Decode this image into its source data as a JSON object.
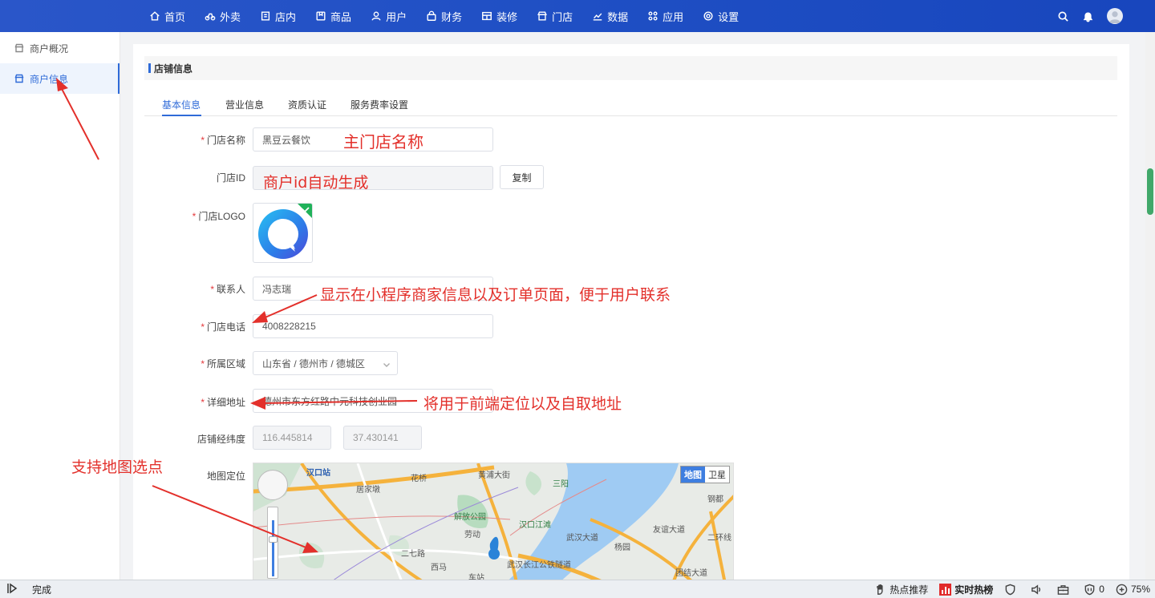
{
  "nav": {
    "items": [
      {
        "label": "首页",
        "icon": "home-icon"
      },
      {
        "label": "外卖",
        "icon": "bike-icon"
      },
      {
        "label": "店内",
        "icon": "store-inside-icon"
      },
      {
        "label": "商品",
        "icon": "goods-icon"
      },
      {
        "label": "用户",
        "icon": "user-icon"
      },
      {
        "label": "财务",
        "icon": "finance-icon"
      },
      {
        "label": "装修",
        "icon": "decorate-icon"
      },
      {
        "label": "门店",
        "icon": "shop-icon"
      },
      {
        "label": "数据",
        "icon": "chart-icon"
      },
      {
        "label": "应用",
        "icon": "apps-icon"
      },
      {
        "label": "设置",
        "icon": "gear-icon"
      }
    ]
  },
  "sidebar": {
    "items": [
      {
        "label": "商户概况",
        "active": false
      },
      {
        "label": "商户信息",
        "active": true
      }
    ]
  },
  "section": {
    "title": "店铺信息"
  },
  "tabs": [
    {
      "label": "基本信息",
      "active": true
    },
    {
      "label": "营业信息",
      "active": false
    },
    {
      "label": "资质认证",
      "active": false
    },
    {
      "label": "服务费率设置",
      "active": false
    }
  ],
  "form": {
    "store_name": {
      "label": "门店名称",
      "value": "黑豆云餐饮",
      "required": true
    },
    "store_id": {
      "label": "门店ID",
      "value": "",
      "copy_button": "复制",
      "required": false
    },
    "logo": {
      "label": "门店LOGO",
      "required": true
    },
    "contact": {
      "label": "联系人",
      "value": "冯志瑞",
      "required": true
    },
    "phone": {
      "label": "门店电话",
      "value": "4008228215",
      "required": true
    },
    "region": {
      "label": "所属区域",
      "value": "山东省 / 德州市 / 德城区",
      "required": true
    },
    "address": {
      "label": "详细地址",
      "value": "德州市东方红路中元科技创业园",
      "required": true
    },
    "latlng": {
      "label": "店铺经纬度",
      "lng": "116.445814",
      "lat": "37.430141"
    },
    "map": {
      "label": "地图定位",
      "type_map": "地图",
      "type_satellite": "卫星",
      "places": [
        "汉口站",
        "居家墩",
        "花桥",
        "解放公园",
        "汉口江滩",
        "劳动",
        "武汉大道",
        "杨园",
        "友谊大道",
        "西马",
        "车站",
        "二七路",
        "钢都",
        "三阳",
        "黄浦大街",
        "武汉长江公铁隧道",
        "团结大道",
        "二环线"
      ]
    }
  },
  "annotations": {
    "store_name": "主门店名称",
    "store_id": "商户id自动生成",
    "contact": "显示在小程序商家信息以及订单页面，便于用户联系",
    "address": "将用于前端定位以及自取地址",
    "map": "支持地图选点"
  },
  "statusbar": {
    "status": "完成",
    "hot_recommend": "热点推荐",
    "realtime_hot": "实时热榜",
    "count": "0",
    "zoom": "75%"
  },
  "colors": {
    "nav_bg": "#1f4fc4",
    "accent": "#2f6bd8",
    "annotation": "#e3302b",
    "required": "#e4393c"
  }
}
